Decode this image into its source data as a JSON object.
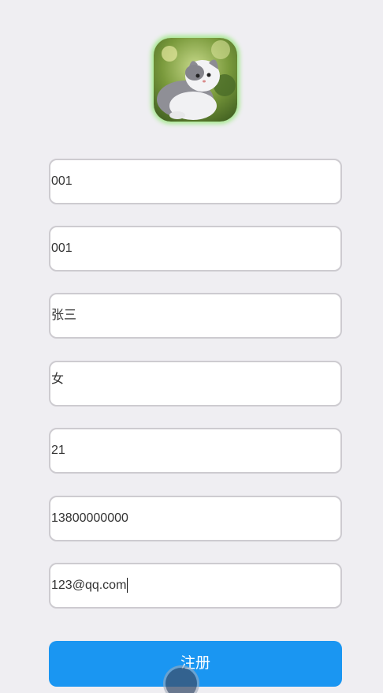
{
  "form": {
    "fields": [
      {
        "value": "001"
      },
      {
        "value": "001"
      },
      {
        "value": "张三"
      },
      {
        "value": "女"
      },
      {
        "value": "21"
      },
      {
        "value": "13800000000"
      },
      {
        "value": "123@qq.com"
      }
    ],
    "submit_label": "注册"
  },
  "colors": {
    "background": "#efeef2",
    "accent": "#1a96f2",
    "avatar_glow": "#a6e88f",
    "field_border": "#cdcbd0"
  },
  "icons": {
    "avatar": "cat-photo"
  }
}
